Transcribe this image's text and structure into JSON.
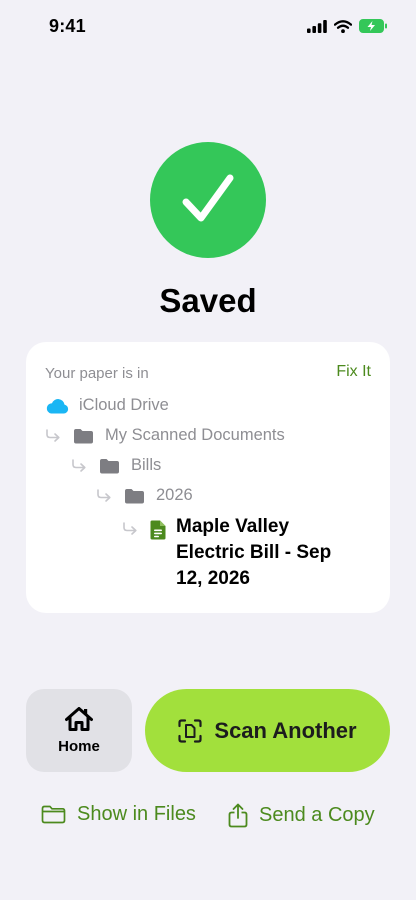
{
  "status_bar": {
    "time": "9:41"
  },
  "result": {
    "title": "Saved"
  },
  "location": {
    "heading": "Your paper is in",
    "fix_label": "Fix It",
    "root": "iCloud Drive",
    "folders": [
      "My Scanned Documents",
      "Bills",
      "2026"
    ],
    "file_name": "Maple Valley Electric Bill - Sep 12, 2026"
  },
  "actions": {
    "home_label": "Home",
    "scan_label": "Scan Another",
    "show_files_label": "Show in Files",
    "send_copy_label": "Send a Copy"
  },
  "colors": {
    "background": "#f2f1f7",
    "success_green": "#34c759",
    "accent_green": "#a2e03c",
    "link_green": "#4c8a1e",
    "icloud_blue": "#1ab6f4"
  },
  "icons": {
    "status": [
      "cellular-signal-icon",
      "wifi-icon",
      "battery-charging-icon"
    ],
    "success": "checkmark-icon",
    "path": [
      "icloud-icon",
      "folder-icon",
      "document-icon",
      "subfolder-arrow-icon"
    ],
    "actions": [
      "home-icon",
      "scan-document-icon",
      "folder-outline-icon",
      "share-icon"
    ]
  }
}
